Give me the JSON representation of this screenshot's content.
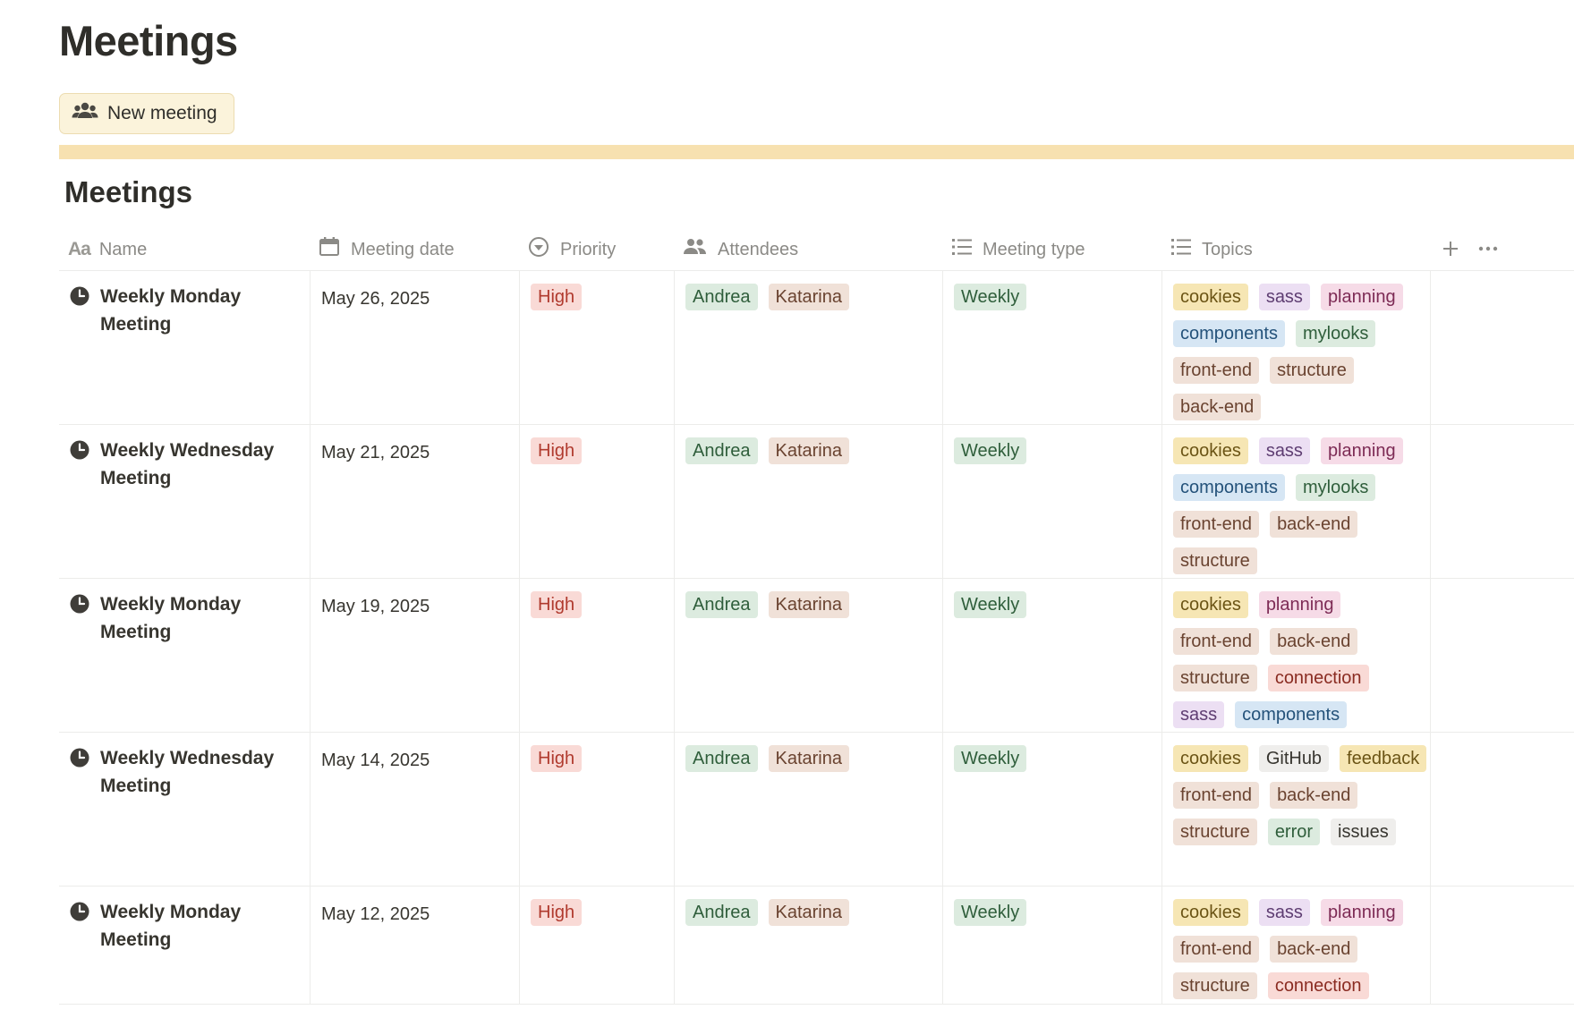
{
  "page": {
    "title": "Meetings",
    "new_button_label": "New meeting",
    "section_title": "Meetings"
  },
  "columns": {
    "name": "Name",
    "date": "Meeting date",
    "priority": "Priority",
    "attendees": "Attendees",
    "type": "Meeting type",
    "topics": "Topics",
    "name_icon_text": "Aa"
  },
  "tag_colors": {
    "cookies": {
      "bg": "#f6e6b4",
      "fg": "#6b5415"
    },
    "sass": {
      "bg": "#ecdff3",
      "fg": "#5e3d72"
    },
    "planning": {
      "bg": "#f6dbe7",
      "fg": "#7d2b55"
    },
    "components": {
      "bg": "#d6e6f4",
      "fg": "#24527a"
    },
    "mylooks": {
      "bg": "#dcebdf",
      "fg": "#2f5e3b"
    },
    "front-end": {
      "bg": "#f0e1d8",
      "fg": "#6a4330"
    },
    "structure": {
      "bg": "#f0e1d8",
      "fg": "#6a4330"
    },
    "back-end": {
      "bg": "#f0e1d8",
      "fg": "#6a4330"
    },
    "connection": {
      "bg": "#f9dad6",
      "fg": "#8a2c22"
    },
    "GitHub": {
      "bg": "#efeeec",
      "fg": "#37352f"
    },
    "feedback": {
      "bg": "#f6e6b4",
      "fg": "#6b5415"
    },
    "error": {
      "bg": "#dcebdf",
      "fg": "#2f5e3b"
    },
    "issues": {
      "bg": "#efeeec",
      "fg": "#37352f"
    },
    "High": {
      "bg": "#f9dad6",
      "fg": "#b03a2e"
    },
    "Andrea": {
      "bg": "#dcebdf",
      "fg": "#2f5e3b"
    },
    "Katarina": {
      "bg": "#f0e1d8",
      "fg": "#6a4330"
    },
    "Weekly": {
      "bg": "#dcebdf",
      "fg": "#2f5e3b"
    }
  },
  "rows": [
    {
      "name": "Weekly Monday Meeting",
      "date": "May 26, 2025",
      "priority": "High",
      "attendees": [
        "Andrea",
        "Katarina"
      ],
      "type": "Weekly",
      "topics": [
        "cookies",
        "sass",
        "planning",
        "components",
        "mylooks",
        "front-end",
        "structure",
        "back-end"
      ]
    },
    {
      "name": "Weekly Wednesday Meeting",
      "date": "May 21, 2025",
      "priority": "High",
      "attendees": [
        "Andrea",
        "Katarina"
      ],
      "type": "Weekly",
      "topics": [
        "cookies",
        "sass",
        "planning",
        "components",
        "mylooks",
        "front-end",
        "back-end",
        "structure"
      ]
    },
    {
      "name": "Weekly Monday Meeting",
      "date": "May 19, 2025",
      "priority": "High",
      "attendees": [
        "Andrea",
        "Katarina"
      ],
      "type": "Weekly",
      "topics": [
        "cookies",
        "planning",
        "front-end",
        "back-end",
        "structure",
        "connection",
        "sass",
        "components"
      ]
    },
    {
      "name": "Weekly Wednesday Meeting",
      "date": "May 14, 2025",
      "priority": "High",
      "attendees": [
        "Andrea",
        "Katarina"
      ],
      "type": "Weekly",
      "topics": [
        "cookies",
        "GitHub",
        "feedback",
        "front-end",
        "back-end",
        "structure",
        "error",
        "issues"
      ]
    },
    {
      "name": "Weekly Monday Meeting",
      "date": "May 12, 2025",
      "priority": "High",
      "attendees": [
        "Andrea",
        "Katarina"
      ],
      "type": "Weekly",
      "topics": [
        "cookies",
        "sass",
        "planning",
        "front-end",
        "back-end",
        "structure",
        "connection"
      ]
    }
  ]
}
